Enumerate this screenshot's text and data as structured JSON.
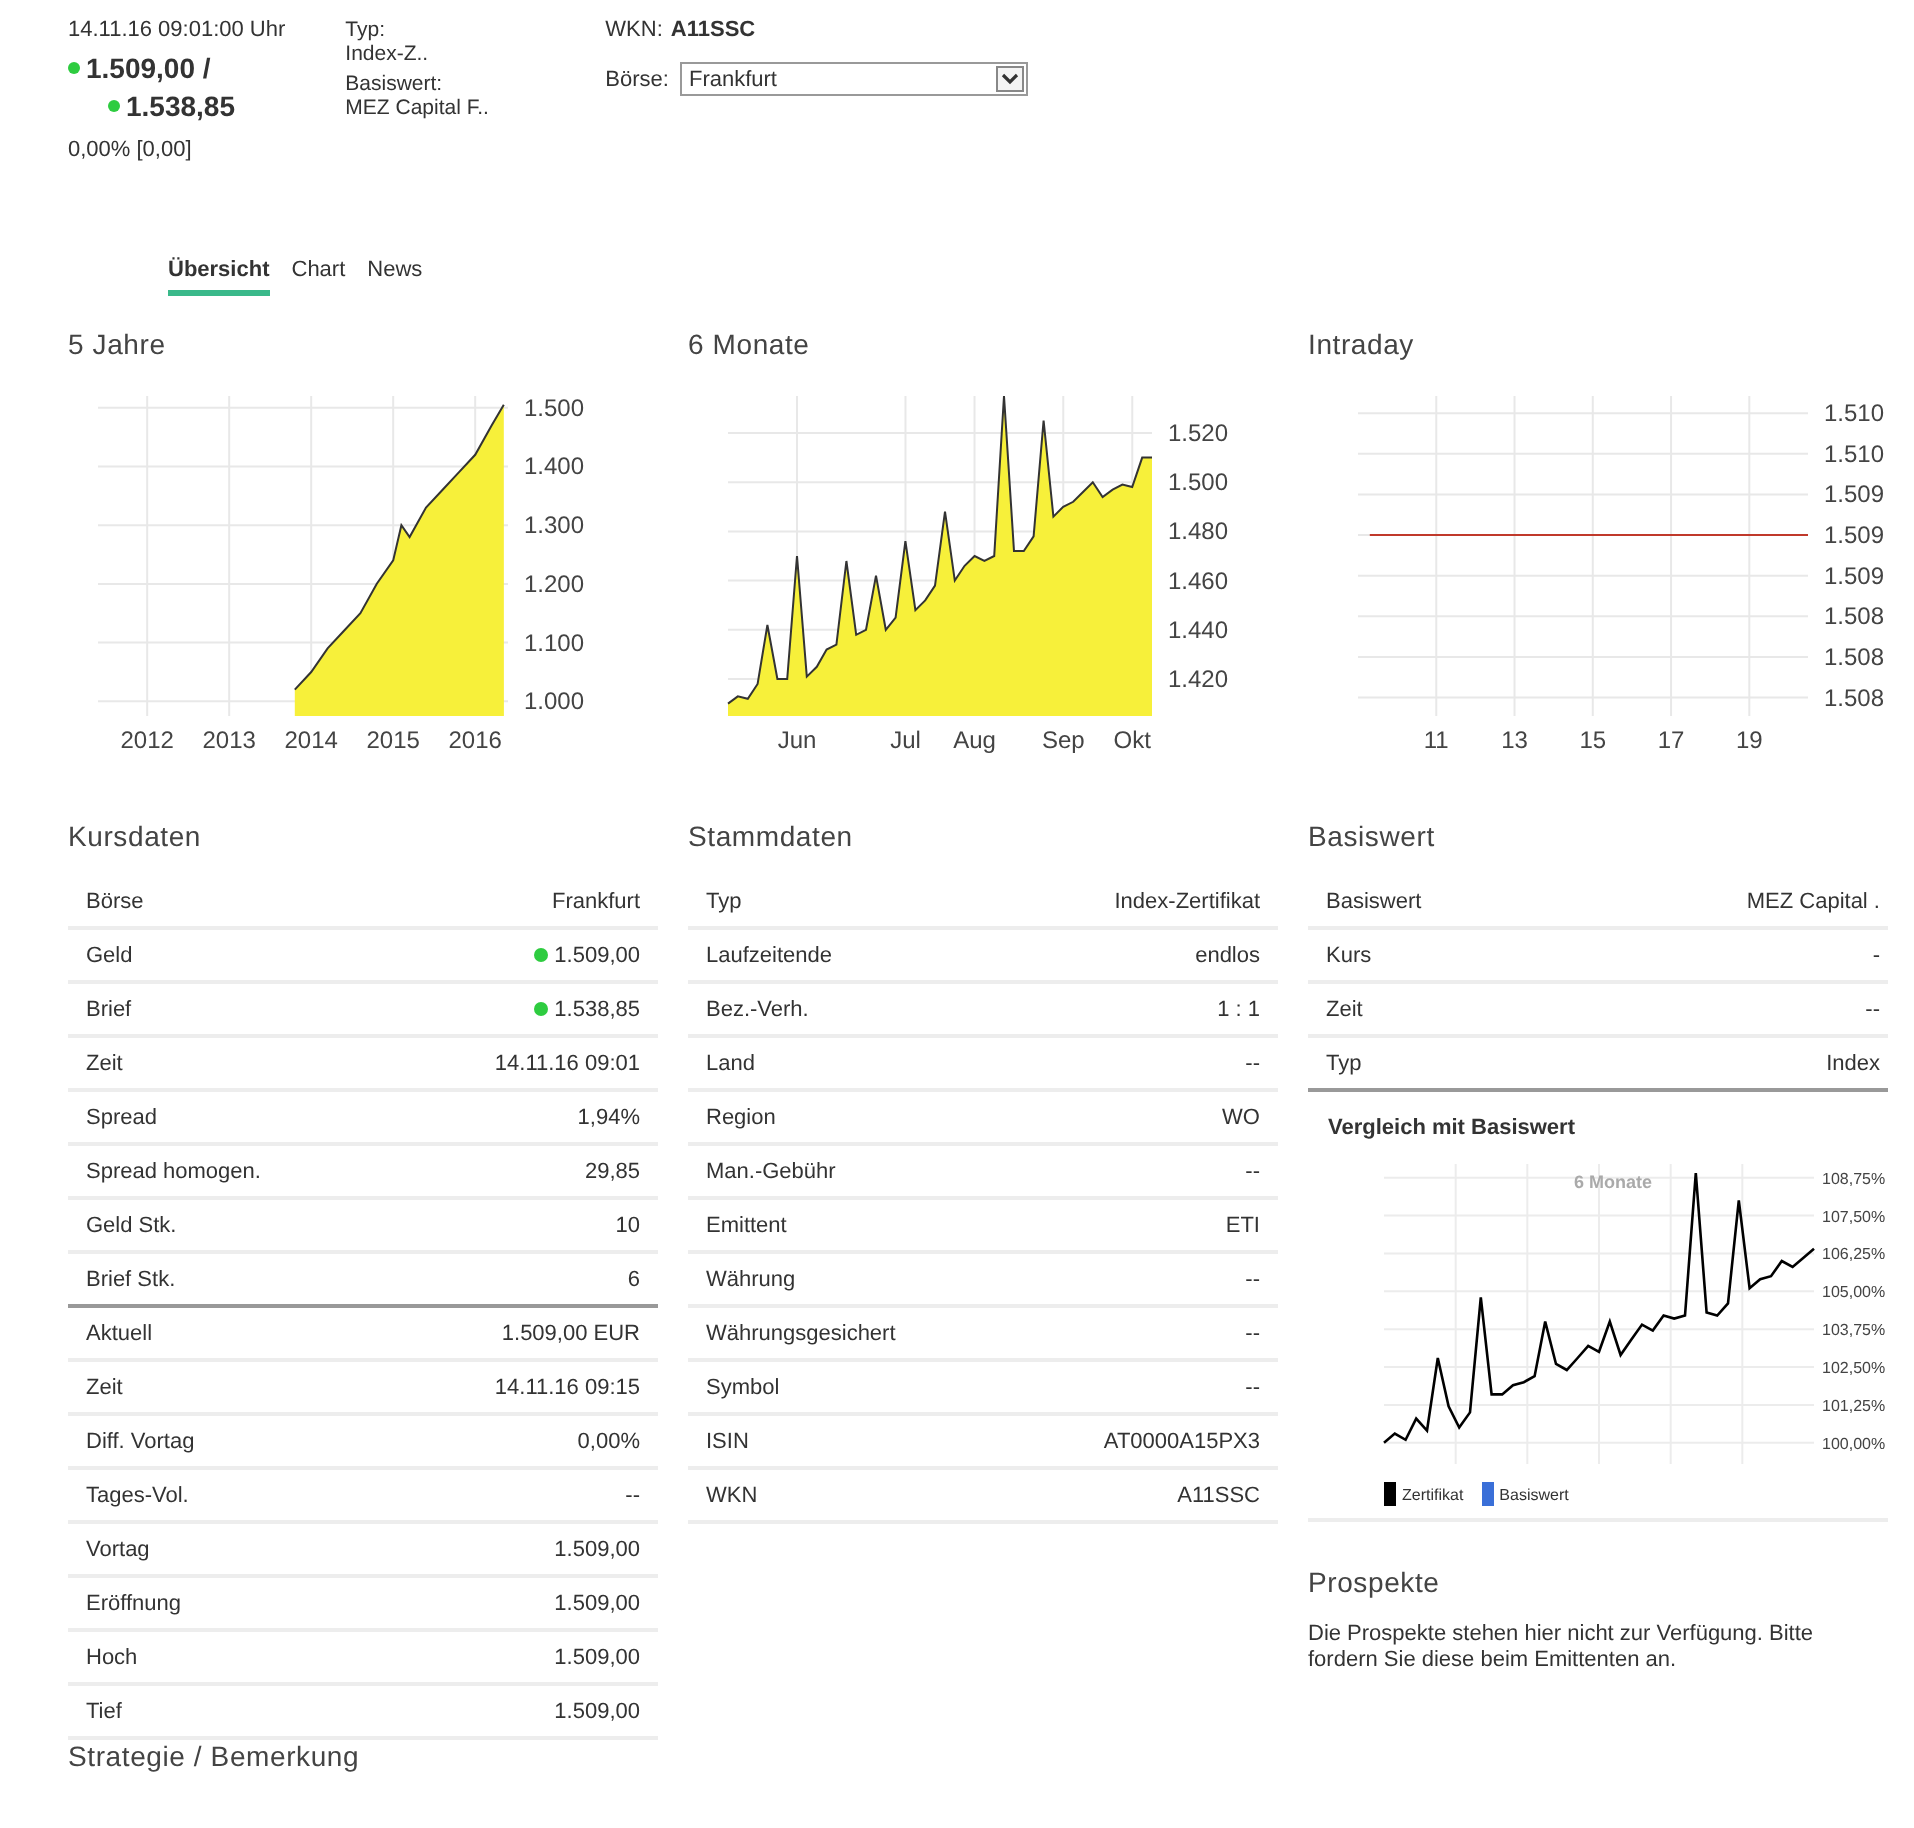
{
  "header": {
    "timestamp": "14.11.16  09:01:00 Uhr",
    "bid": {
      "value": "1.509,00 /",
      "color": "#2ecc40"
    },
    "ask": {
      "value": "1.538,85",
      "color": "#2ecc40"
    },
    "change": "0,00%  [0,00]",
    "info": [
      {
        "label": "Typ:",
        "value": "Index-Z.."
      },
      {
        "label": "Basiswert:",
        "value": "MEZ Capital F.."
      }
    ],
    "wkn_label": "WKN:",
    "wkn": "A11SSC",
    "exchange_label": "Börse:",
    "exchange": "Frankfurt"
  },
  "tabs": [
    {
      "label": "Übersicht",
      "selected": true
    },
    {
      "label": "Chart",
      "selected": false
    },
    {
      "label": "News",
      "selected": false
    }
  ],
  "charts": [
    {
      "title": "5 Jahre",
      "chart_data": {
        "type": "area",
        "grid": true,
        "x": [
          2013.8,
          2014.0,
          2014.2,
          2014.4,
          2014.6,
          2014.8,
          2015.0,
          2015.1,
          2015.2,
          2015.4,
          2015.6,
          2015.8,
          2016.0,
          2016.2,
          2016.35
        ],
        "series": [
          {
            "color": "#333333",
            "values": [
              1020,
              1050,
              1090,
              1120,
              1150,
              1200,
              1240,
              1300,
              1280,
              1330,
              1360,
              1390,
              1420,
              1470,
              1505
            ]
          }
        ],
        "xlim": [
          2011.4,
          2016.4
        ],
        "ylim": [
          975,
          1520
        ],
        "xticks": [
          2012,
          2013,
          2014,
          2015,
          2016
        ],
        "yticks": [
          {
            "value": 1000,
            "label": "1.000"
          },
          {
            "value": 1100,
            "label": "1.100"
          },
          {
            "value": 1200,
            "label": "1.200"
          },
          {
            "value": 1300,
            "label": "1.300"
          },
          {
            "value": 1400,
            "label": "1.400"
          },
          {
            "value": 1500,
            "label": "1.500"
          }
        ]
      }
    },
    {
      "title": "6 Monate",
      "chart_data": {
        "type": "area",
        "grid": true,
        "categories": [
          null,
          null,
          null,
          null,
          null,
          null,
          null,
          "Jun",
          null,
          null,
          null,
          null,
          null,
          null,
          null,
          null,
          null,
          null,
          "Jul",
          null,
          null,
          null,
          null,
          null,
          null,
          "Aug",
          null,
          null,
          null,
          null,
          null,
          null,
          null,
          null,
          "Sep",
          null,
          null,
          null,
          null,
          null,
          null,
          "Okt",
          null,
          null
        ],
        "series": [
          {
            "color": "#333333",
            "values": [
              1410,
              1413,
              1412,
              1418,
              1442,
              1420,
              1420,
              1470,
              1421,
              1425,
              1432,
              1434,
              1468,
              1438,
              1440,
              1462,
              1440,
              1445,
              1476,
              1448,
              1452,
              1458,
              1488,
              1460,
              1466,
              1470,
              1468,
              1470,
              1535,
              1472,
              1472,
              1478,
              1525,
              1486,
              1490,
              1492,
              1496,
              1500,
              1494,
              1497,
              1499,
              1498,
              1510,
              1510
            ]
          }
        ],
        "ylim": [
          1405,
          1535
        ],
        "yticks": [
          {
            "value": 1420,
            "label": "1.420"
          },
          {
            "value": 1440,
            "label": "1.440"
          },
          {
            "value": 1460,
            "label": "1.460"
          },
          {
            "value": 1480,
            "label": "1.480"
          },
          {
            "value": 1500,
            "label": "1.500"
          },
          {
            "value": 1520,
            "label": "1.520"
          }
        ]
      }
    },
    {
      "title": "Intraday",
      "chart_data": {
        "type": "line",
        "grid": true,
        "x": [
          9.3,
          20.5
        ],
        "series": [
          {
            "color": "#c0392b",
            "values": [
              1508.87,
              1508.87
            ]
          }
        ],
        "xlim": [
          9,
          20.5
        ],
        "ylim": [
          1507.4,
          1510.0
        ],
        "xticks": [
          11,
          13,
          15,
          17,
          19
        ],
        "yticks": [
          {
            "value": 1507.55,
            "label": "1.508"
          },
          {
            "value": 1507.88,
            "label": "1.508"
          },
          {
            "value": 1508.21,
            "label": "1.508"
          },
          {
            "value": 1508.54,
            "label": "1.509"
          },
          {
            "value": 1508.87,
            "label": "1.509"
          },
          {
            "value": 1509.2,
            "label": "1.509"
          },
          {
            "value": 1509.53,
            "label": "1.510"
          },
          {
            "value": 1509.86,
            "label": "1.510"
          }
        ]
      }
    }
  ],
  "kursdaten": {
    "title": "Kursdaten",
    "groups": [
      {
        "rows": [
          {
            "label": "Börse",
            "value": "Frankfurt"
          },
          {
            "label": "Geld",
            "value": "1.509,00",
            "color": "#2ecc40"
          },
          {
            "label": "Brief",
            "value": "1.538,85",
            "color": "#2ecc40"
          },
          {
            "label": "Zeit",
            "value": "14.11.16 09:01"
          },
          {
            "label": "Spread",
            "value": "1,94%"
          },
          {
            "label": "Spread homogen.",
            "value": "29,85"
          },
          {
            "label": "Geld Stk.",
            "value": "10"
          },
          {
            "label": "Brief Stk.",
            "value": "6"
          }
        ]
      },
      {
        "rows": [
          {
            "label": "Aktuell",
            "value": "1.509,00 EUR"
          },
          {
            "label": "Zeit",
            "value": "14.11.16 09:15"
          },
          {
            "label": "Diff. Vortag",
            "value": "0,00%"
          },
          {
            "label": "Tages-Vol.",
            "value": "--"
          },
          {
            "label": "Vortag",
            "value": "1.509,00"
          },
          {
            "label": "Eröffnung",
            "value": "1.509,00"
          },
          {
            "label": "Hoch",
            "value": "1.509,00"
          },
          {
            "label": "Tief",
            "value": "1.509,00"
          }
        ]
      }
    ]
  },
  "stammdaten": {
    "title": "Stammdaten",
    "rows": [
      {
        "label": "Typ",
        "value": "Index-Zertifikat"
      },
      {
        "label": "Laufzeitende",
        "value": "endlos"
      },
      {
        "label": "Bez.-Verh.",
        "value": "1 : 1"
      },
      {
        "label": "Land",
        "value": "--"
      },
      {
        "label": "Region",
        "value": "WO"
      },
      {
        "label": "Man.-Gebühr",
        "value": "--"
      },
      {
        "label": "Emittent",
        "value": "ETI"
      },
      {
        "label": "Währung",
        "value": "--"
      },
      {
        "label": "Währungsgesichert",
        "value": "--"
      },
      {
        "label": "Symbol",
        "value": "--"
      },
      {
        "label": "ISIN",
        "value": "AT0000A15PX3"
      },
      {
        "label": "WKN",
        "value": "A11SSC"
      }
    ]
  },
  "basiswert": {
    "title": "Basiswert",
    "rows": [
      {
        "label": "Basiswert",
        "value": "MEZ Capital ."
      },
      {
        "label": "Kurs",
        "value": "-"
      },
      {
        "label": "Zeit",
        "value": "--"
      },
      {
        "label": "Typ",
        "value": "Index"
      }
    ],
    "comparison": {
      "title": "Vergleich mit Basiswert",
      "chart_data": {
        "type": "line",
        "grid": true,
        "series": [
          {
            "name": "Zertifikat",
            "color": "#000000",
            "values": [
              100.0,
              100.3,
              100.1,
              100.8,
              100.4,
              102.8,
              101.2,
              100.5,
              101.0,
              104.8,
              101.6,
              101.6,
              101.9,
              102.0,
              102.2,
              104.0,
              102.6,
              102.4,
              102.8,
              103.2,
              103.0,
              104.0,
              102.9,
              103.4,
              103.9,
              103.7,
              104.2,
              104.1,
              104.2,
              108.9,
              104.3,
              104.2,
              104.6,
              108.0,
              105.1,
              105.4,
              105.5,
              106.0,
              105.8,
              106.1,
              106.4
            ]
          },
          {
            "name": "Basiswert",
            "color": "#3a6fd8"
          }
        ],
        "ylim": [
          99.3,
          109.2
        ],
        "yticks": [
          {
            "value": 100,
            "label": "100,00%"
          },
          {
            "value": 101.25,
            "label": "101,25%"
          },
          {
            "value": 102.5,
            "label": "102,50%"
          },
          {
            "value": 103.75,
            "label": "103,75%"
          },
          {
            "value": 105,
            "label": "105,00%"
          },
          {
            "value": 106.25,
            "label": "106,25%"
          },
          {
            "value": 107.5,
            "label": "107,50%"
          },
          {
            "value": 108.75,
            "label": "108,75%"
          }
        ],
        "annotations": [
          "6 Monate"
        ]
      }
    }
  },
  "prospekte": {
    "title": "Prospekte",
    "text": "Die Prospekte stehen hier nicht zur Verfügung. Bitte fordern Sie diese beim Emittenten an."
  },
  "strategie": {
    "title": "Strategie / Bemerkung"
  }
}
